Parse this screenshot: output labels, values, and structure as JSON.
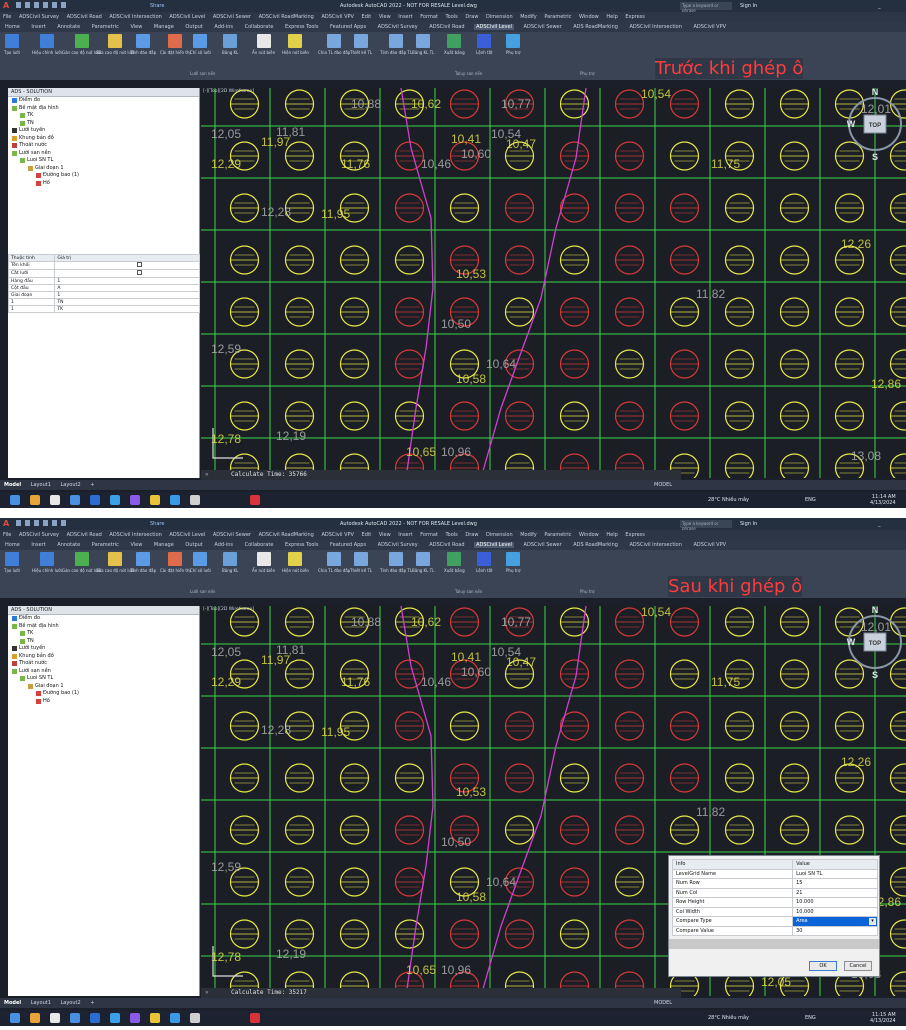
{
  "app": {
    "title_before": "Autodesk AutoCAD 2022 - NOT FOR RESALE   Level.dwg",
    "title_after": "Autodesk AutoCAD 2022 - NOT FOR RESALE   Level.dwg",
    "share": "Share",
    "search_placeholder": "Type a keyword or phrase",
    "sign_in": "Sign In"
  },
  "menu": [
    "File",
    "ADSCivil Survey",
    "ADSCivil Road",
    "ADSCivil Intersection",
    "ADSCivil Level",
    "ADSCivil Sewer",
    "ADSCivil RoadMarking",
    "ADSCivil VPV",
    "Edit",
    "View",
    "Insert",
    "Format",
    "Tools",
    "Draw",
    "Dimension",
    "Modify",
    "Parametric",
    "Window",
    "Help",
    "Express"
  ],
  "tabs": [
    "Home",
    "Insert",
    "Annotate",
    "Parametric",
    "View",
    "Manage",
    "Output",
    "Add-ins",
    "Collaborate",
    "Express Tools",
    "Featured Apps",
    "ADSCivil Survey",
    "ADSCivil Road",
    "ADSCivil Level",
    "ADSCivil Sewer",
    "ADS RoadMarking",
    "ADSCivil Intersection",
    "ADSCivil VPV"
  ],
  "active_tab": "ADSCivil Level",
  "ribbon": {
    "buttons": [
      "Tạo lưới",
      "Hiệu chỉnh lưới",
      "Gán cao độ nút lưới",
      "Sửa cao độ nút lưới",
      "Tính đào đắp",
      "Cài đặt hiển thị",
      "Chỉ số lưới",
      "Bảng KL",
      "Ẩn nút biên",
      "Hiện nút biên",
      "Chia TL đào đắp",
      "Thiết kế TL",
      "Tính đào đắp TL",
      "Bảng KL TL",
      "Xuất bảng",
      "Lệnh tắt",
      "Phụ trợ"
    ],
    "groups": [
      "Lưới san nền",
      "Taluy san nền",
      "Phụ trợ"
    ],
    "button_colors": [
      "#3f7fd8",
      "#3f7fd8",
      "#4caf50",
      "#e3c14a",
      "#5b9be6",
      "#e06b4a",
      "#5b9be6",
      "#6a9fd8",
      "#e8e8e8",
      "#e0d04a",
      "#7aa6de",
      "#7aa6de",
      "#7aa6de",
      "#7aa6de",
      "#3fa060",
      "#3a5fd8",
      "#46a0e0"
    ]
  },
  "overlay": {
    "before": "Trước khi ghép ô",
    "after": "Sau khi ghép ô"
  },
  "sidepanel": {
    "title": "ADS - SOLUTION",
    "tree": [
      {
        "label": "Điểm đo",
        "level": 0,
        "color": "#2a7bd8"
      },
      {
        "label": "Bề mặt địa hình",
        "level": 0,
        "color": "#7ab648"
      },
      {
        "label": "TK",
        "level": 1,
        "color": "#7ab648"
      },
      {
        "label": "TN",
        "level": 1,
        "color": "#7ab648"
      },
      {
        "label": "Lưới tuyến",
        "level": 0,
        "color": "#333333"
      },
      {
        "label": "Khung bản đồ",
        "level": 0,
        "color": "#d8a02a"
      },
      {
        "label": "Thoát nước",
        "level": 0,
        "color": "#c04040"
      },
      {
        "label": "Lưới san nền",
        "level": 0,
        "color": "#7ab648"
      },
      {
        "label": "Luoi SN TL",
        "level": 1,
        "color": "#7ab648"
      },
      {
        "label": "Giai đoạn 1",
        "level": 2,
        "color": "#c8a040"
      },
      {
        "label": "Đường bao (1)",
        "level": 3,
        "color": "#d84040"
      },
      {
        "label": "Hố",
        "level": 3,
        "color": "#d84040"
      }
    ],
    "props_header": [
      "Thuộc tính",
      "Giá trị"
    ],
    "props": [
      [
        "Tên khối",
        ""
      ],
      [
        "Cắt lưới",
        ""
      ],
      [
        "Hàng đầu",
        "1"
      ],
      [
        "Cột đầu",
        "A"
      ],
      [
        "Giai đoạn",
        "1"
      ],
      [
        "1",
        "TN"
      ],
      [
        "1",
        "TK"
      ]
    ]
  },
  "viewport": {
    "label": "[-][Top][2D Wireframe]",
    "cmd_before": "Calculate Time: 35766",
    "cmd_after": "Calculate Time: 35217",
    "cad_labels_before": [
      "12,05",
      "12,29",
      "12,59",
      "12,78",
      "12,19",
      "10,53",
      "10,50",
      "10,58",
      "10,64",
      "11,75",
      "11,82",
      "12,26",
      "12,01",
      "12,86",
      "13,08",
      "10,41",
      "10,54",
      "10,47",
      "10,60",
      "10,62",
      "10,77",
      "10,54",
      "10,46",
      "11,97",
      "11,81",
      "11,76",
      "12,28",
      "11,95",
      "10,88",
      "10,65",
      "10,96"
    ],
    "cad_labels_after": [
      "12,05",
      "12,29",
      "12,59",
      "12,78",
      "12,19",
      "10,53",
      "10,50",
      "10,58",
      "10,64",
      "11,75",
      "11,82",
      "12,26",
      "12,01",
      "12,86",
      "13,08",
      "10,41",
      "10,54",
      "10,47",
      "10,60",
      "10,62",
      "10,77",
      "10,54",
      "10,46",
      "11,97",
      "11,81",
      "11,76",
      "12,28",
      "11,95",
      "10,88",
      "10,65",
      "10,96",
      "12,05"
    ]
  },
  "navcube": {
    "n": "N",
    "w": "W",
    "s": "S",
    "top": "TOP"
  },
  "layouts": [
    "Model",
    "Layout1",
    "Layout2",
    "+"
  ],
  "status": "MODEL",
  "taskbar": {
    "weather": "28°C  Nhiều mây",
    "lang": "ENG",
    "time_before": "11:14 AM",
    "date_before": "4/13/2024",
    "time_after": "11:15 AM",
    "date_after": "4/13/2024"
  },
  "dialog": {
    "header": [
      "Info",
      "Value"
    ],
    "rows": [
      [
        "LevelGrid Name",
        "Luoi SN TL"
      ],
      [
        "Num Row",
        "15"
      ],
      [
        "Num Col",
        "21"
      ],
      [
        "Row Height",
        "10.000"
      ],
      [
        "Col Width",
        "10.000"
      ],
      [
        "Compare Type",
        "Area"
      ],
      [
        "Compare Value",
        "30"
      ]
    ],
    "ok": "OK",
    "cancel": "Cancel"
  },
  "colors": {
    "grid_green": "#39d64a",
    "circle_yellow": "#e8e84a",
    "circle_red": "#d83a3a",
    "boundary_magenta": "#d040d0",
    "overlay_red": "#ff3b3b"
  }
}
